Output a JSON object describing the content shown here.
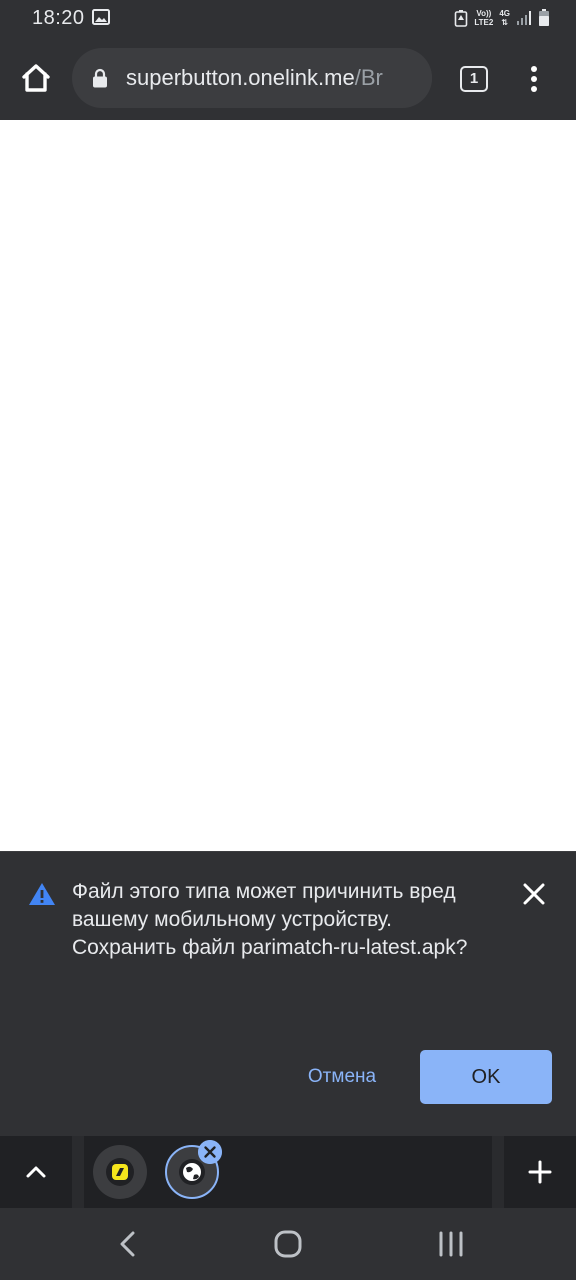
{
  "status_bar": {
    "time": "18:20",
    "net_top": "Vo))",
    "net_bottom": "LTE2",
    "net_type": "4G"
  },
  "toolbar": {
    "url_host": "superbutton.onelink.me",
    "url_path": "/Br",
    "tab_count": "1"
  },
  "download_warning": {
    "message": "Файл этого типа может причинить вред вашему мобильному устройству. Сохранить файл parimatch-ru-latest.apk?",
    "cancel_label": "Отмена",
    "ok_label": "OK"
  },
  "colors": {
    "background": "#303134",
    "accent": "#8ab4f8",
    "warning": "#4285f4"
  }
}
